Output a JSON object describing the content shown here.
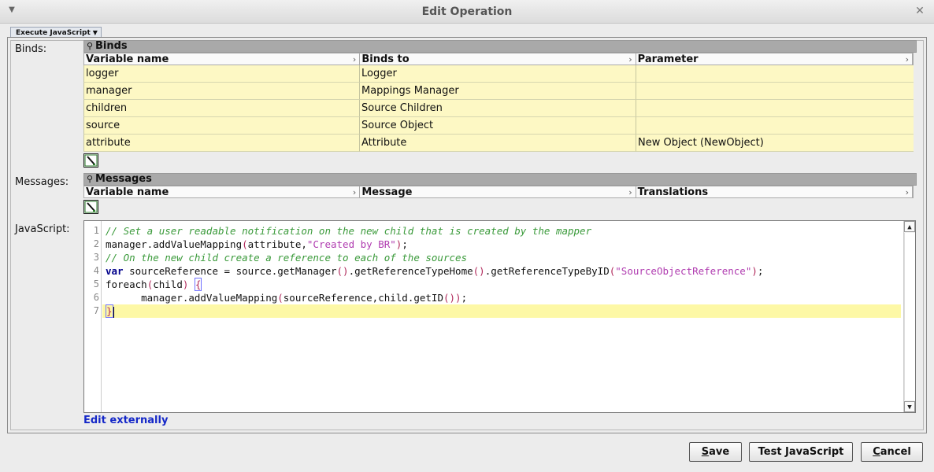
{
  "window": {
    "title": "Edit Operation"
  },
  "tab": {
    "label": "Execute JavaScript"
  },
  "labels": {
    "binds": "Binds:",
    "messages": "Messages:",
    "javascript": "JavaScript:"
  },
  "binds": {
    "section_title": "Binds",
    "columns": [
      "Variable name",
      "Binds to",
      "Parameter"
    ],
    "rows": [
      [
        "logger",
        "Logger",
        ""
      ],
      [
        "manager",
        "Mappings Manager",
        ""
      ],
      [
        "children",
        "Source Children",
        ""
      ],
      [
        "source",
        "Source Object",
        ""
      ],
      [
        "attribute",
        "Attribute",
        "New Object (NewObject)"
      ]
    ]
  },
  "messages": {
    "section_title": "Messages",
    "columns": [
      "Variable name",
      "Message",
      "Translations"
    ]
  },
  "editor": {
    "line_numbers": [
      "1",
      "2",
      "3",
      "4",
      "5",
      "6",
      "7"
    ],
    "code": {
      "l1": "// Set a user readable notification on the new child that is created by the mapper",
      "l2a": "manager.addValueMapping",
      "l2b": "(",
      "l2c": "attribute,",
      "l2d": "\"Created by BR\"",
      "l2e": ")",
      "l2f": ";",
      "l3": "// On the new child create a reference to each of the sources",
      "l4a": "var",
      "l4b": " sourceReference = source.getManager",
      "l4c": "()",
      "l4d": ".getReferenceTypeHome",
      "l4e": "()",
      "l4f": ".getReferenceTypeByID",
      "l4g": "(",
      "l4h": "\"SourceObjectReference\"",
      "l4i": ")",
      "l4j": ";",
      "l5a": "foreach",
      "l5b": "(",
      "l5c": "child",
      "l5d": ")",
      "l5e": " ",
      "l5f": "{",
      "l6a": "      manager.addValueMapping",
      "l6b": "(",
      "l6c": "sourceReference,child.getID",
      "l6d": "()",
      "l6e": ")",
      "l6f": ";",
      "l7": "}"
    }
  },
  "edit_externally": "Edit externally",
  "buttons": {
    "save_mnemonic": "S",
    "save_rest": "ave",
    "test": "Test JavaScript",
    "cancel_mnemonic": "C",
    "cancel_rest": "ancel"
  },
  "icons": {
    "window_menu": "chevron-down-icon",
    "close": "close-icon",
    "pin": "pin-icon",
    "edit": "edit-table-icon"
  }
}
